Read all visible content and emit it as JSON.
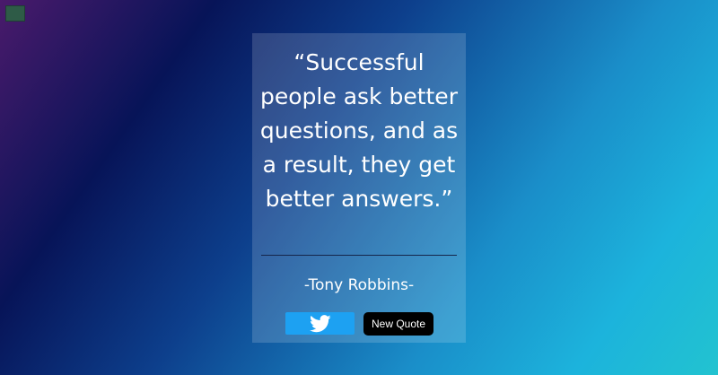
{
  "quote": {
    "text": "“Successful people ask better questions, and as a result, they get better answers.”",
    "author": "-Tony Robbins-"
  },
  "actions": {
    "tweet_icon": "twitter-icon",
    "new_quote_label": "New Quote"
  },
  "colors": {
    "tweet_button": "#1da1f2",
    "new_quote_button": "#000000",
    "text": "#ffffff"
  }
}
